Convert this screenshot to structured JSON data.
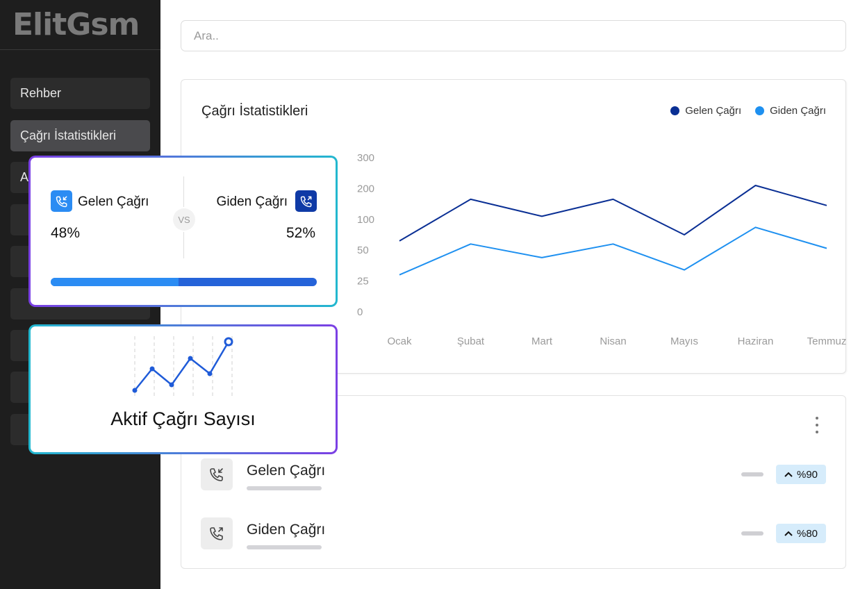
{
  "sidebar": {
    "logo": "ElitGsm",
    "items": [
      {
        "label": "Rehber"
      },
      {
        "label": "Çağrı İstatistikleri"
      },
      {
        "label": "A"
      },
      {
        "label": ""
      },
      {
        "label": ""
      },
      {
        "label": ""
      },
      {
        "label": ""
      },
      {
        "label": ""
      },
      {
        "label": ""
      }
    ]
  },
  "search": {
    "placeholder": "Ara.."
  },
  "stats": {
    "title": "Çağrı İstatistikleri",
    "legend": [
      {
        "label": "Gelen Çağrı",
        "color": "#0a2f94"
      },
      {
        "label": "Giden Çağrı",
        "color": "#1e90f0"
      }
    ]
  },
  "chart_data": {
    "type": "line",
    "categories": [
      "Ocak",
      "Şubat",
      "Mart",
      "Nisan",
      "Mayıs",
      "Haziran",
      "Temmuz"
    ],
    "y_ticks": [
      "300",
      "200",
      "100",
      "50",
      "25",
      "0"
    ],
    "series": [
      {
        "name": "Gelen Çağrı",
        "color": "#0a2f94",
        "values": [
          65,
          165,
          110,
          165,
          75,
          210,
          145
        ]
      },
      {
        "name": "Giden Çağrı",
        "color": "#1e90f0",
        "values": [
          30,
          60,
          44,
          60,
          34,
          87,
          53
        ]
      }
    ],
    "grid": false,
    "legend": "top-right"
  },
  "list": {
    "rows": [
      {
        "label": "Gelen Çağrı",
        "badge": "%90"
      },
      {
        "label": "Giden Çağrı",
        "badge": "%80"
      }
    ]
  },
  "compare": {
    "left_label": "Gelen Çağrı",
    "left_pct": "48%",
    "right_label": "Giden Çağrı",
    "right_pct": "52%",
    "vs": "VS",
    "progress": 0.48
  },
  "active": {
    "title": "Aktif Çağrı Sayısı"
  }
}
